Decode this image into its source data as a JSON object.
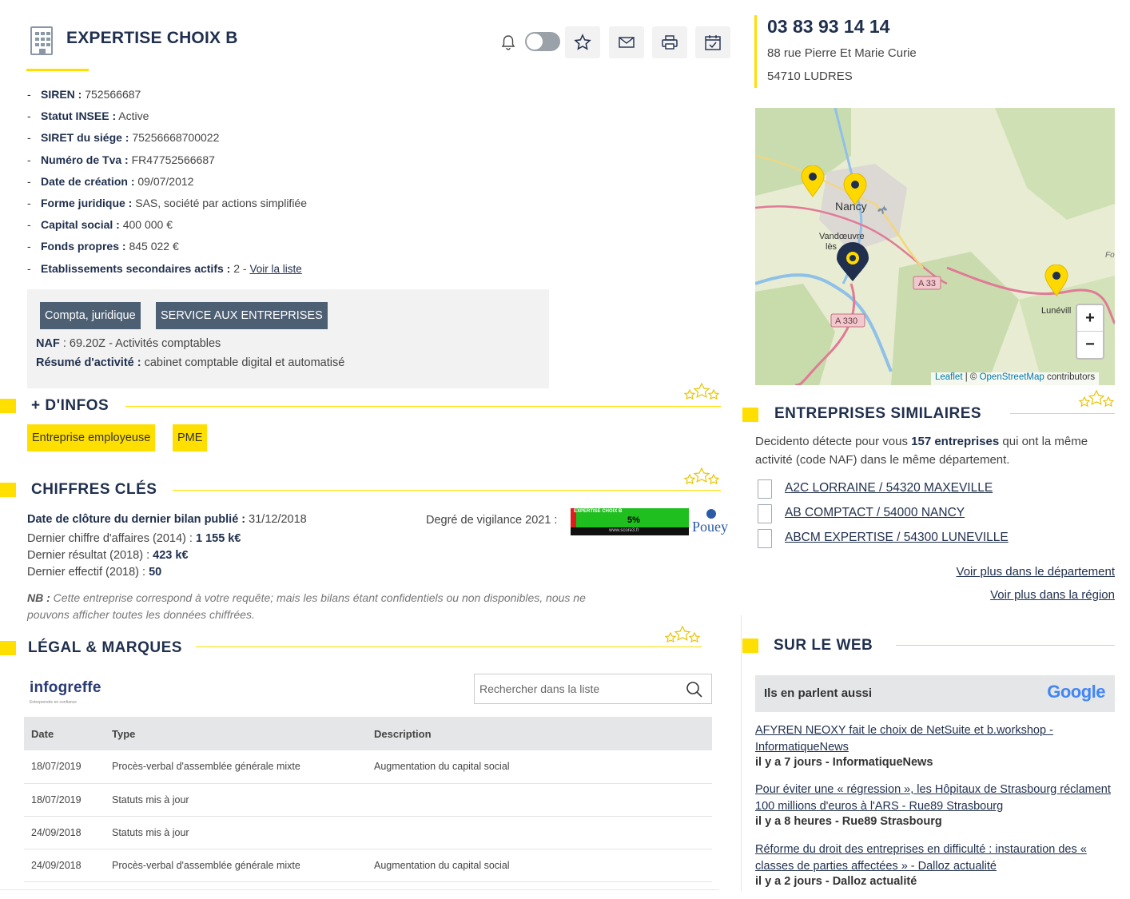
{
  "company": {
    "name": "EXPERTISE CHOIX B",
    "fields": [
      {
        "label": "SIREN :",
        "value": "752566687"
      },
      {
        "label": "Statut INSEE :",
        "value": "Active"
      },
      {
        "label": "SIRET du siége :",
        "value": "75256668700022"
      },
      {
        "label": "Numéro de Tva :",
        "value": "FR47752566687"
      },
      {
        "label": "Date de création :",
        "value": "09/07/2012"
      },
      {
        "label": "Forme juridique :",
        "value": "SAS, société par actions simplifiée"
      },
      {
        "label": "Capital social :",
        "value": "400 000 €"
      },
      {
        "label": "Fonds propres :",
        "value": "845 022 €"
      },
      {
        "label": "Etablissements secondaires actifs :",
        "value": "2 -",
        "link": "Voir la liste"
      }
    ],
    "tags": [
      "Compta, juridique",
      "SERVICE AUX ENTREPRISES"
    ],
    "naf_label": "NAF",
    "naf_value": ": 69.20Z - Activités comptables",
    "resume_label": "Résumé d'activité :",
    "resume_value": "cabinet comptable digital et automatisé"
  },
  "infos": {
    "title": "+ D'INFOS",
    "tags": [
      "Entreprise employeuse",
      "PME"
    ]
  },
  "chiffres": {
    "title": "CHIFFRES CLÉS",
    "cloture_label": "Date de clôture du dernier bilan publié :",
    "cloture_value": "31/12/2018",
    "ca_label": "Dernier chiffre d'affaires (2014) :",
    "ca_value": "1 155 k€",
    "resultat_label": "Dernier résultat (2018) :",
    "resultat_value": "423 k€",
    "effectif_label": "Dernier effectif (2018) :",
    "effectif_value": "50",
    "vigilance_label": "Degré de vigilance 2021 :",
    "vigilance_badge_name": "EXPERTISE CHOIX B",
    "vigilance_value": "5%",
    "vigilance_url": "www.score3.fr",
    "vigilance_level": 0.05,
    "pouey": "Pouey",
    "nb_label": "NB :",
    "nb_text": "Cette entreprise correspond à votre requête; mais les bilans étant confidentiels ou non disponibles, nous ne pouvons afficher toutes les données chiffrées."
  },
  "legal": {
    "title": "LÉGAL & MARQUES",
    "logo": "infogreffe",
    "logo_sub": "Entreprendre en confiance",
    "search_placeholder": "Rechercher dans la liste",
    "columns": [
      "Date",
      "Type",
      "Description"
    ],
    "rows": [
      [
        "18/07/2019",
        "Procès-verbal d'assemblée générale mixte",
        "Augmentation du capital social"
      ],
      [
        "18/07/2019",
        "Statuts mis à jour",
        ""
      ],
      [
        "24/09/2018",
        "Statuts mis à jour",
        ""
      ],
      [
        "24/09/2018",
        "Procès-verbal d'assemblée générale mixte",
        "Augmentation du capital social"
      ]
    ]
  },
  "contact": {
    "phone": "03 83 93 14 14",
    "address_line1": "88 rue Pierre Et Marie Curie",
    "address_line2": "54710 LUDRES"
  },
  "map": {
    "labels": {
      "nancy": "Nancy",
      "vandoeuvre": "Vandœuvre",
      "les": "lès",
      "a33": "A 33",
      "a330": "A 330",
      "luneville": "Lunévill",
      "fo": "Fo"
    },
    "zoom_in": "+",
    "zoom_out": "−",
    "attribution_leaflet": "Leaflet",
    "attribution_sep": "| ©",
    "attribution_osm": "OpenStreetMap",
    "attribution_rest": "contributors"
  },
  "similaires": {
    "title": "ENTREPRISES SIMILAIRES",
    "intro_before": "Decidento détecte pour vous",
    "intro_count": "157 entreprises",
    "intro_after": "qui ont la même activité (code NAF) dans le même département.",
    "items": [
      "A2C LORRAINE / 54320 MAXEVILLE",
      "AB COMPTACT / 54000 NANCY",
      "ABCM EXPERTISE / 54300 LUNEVILLE"
    ],
    "more_departement": "Voir plus dans le département",
    "more_region": "Voir plus dans la région"
  },
  "web": {
    "title": "SUR LE WEB",
    "box_title": "Ils en parlent aussi",
    "google": "Google",
    "news": [
      {
        "title": "AFYREN NEOXY fait le choix de NetSuite et b.workshop - InformatiqueNews",
        "meta": "il y a 7 jours - InformatiqueNews"
      },
      {
        "title": "Pour éviter une « régression », les Hôpitaux de Strasbourg réclament 100 millions d'euros à l'ARS - Rue89 Strasbourg",
        "meta": "il y a 8 heures - Rue89 Strasbourg"
      },
      {
        "title": "Réforme du droit des entreprises en difficulté : instauration des « classes de parties affectées » - Dalloz actualité",
        "meta": "il y a 2 jours - Dalloz actualité"
      }
    ]
  },
  "colors": {
    "accent": "#ffdf00",
    "navy": "#1f2f4d",
    "tag_dark": "#4d5f72"
  }
}
